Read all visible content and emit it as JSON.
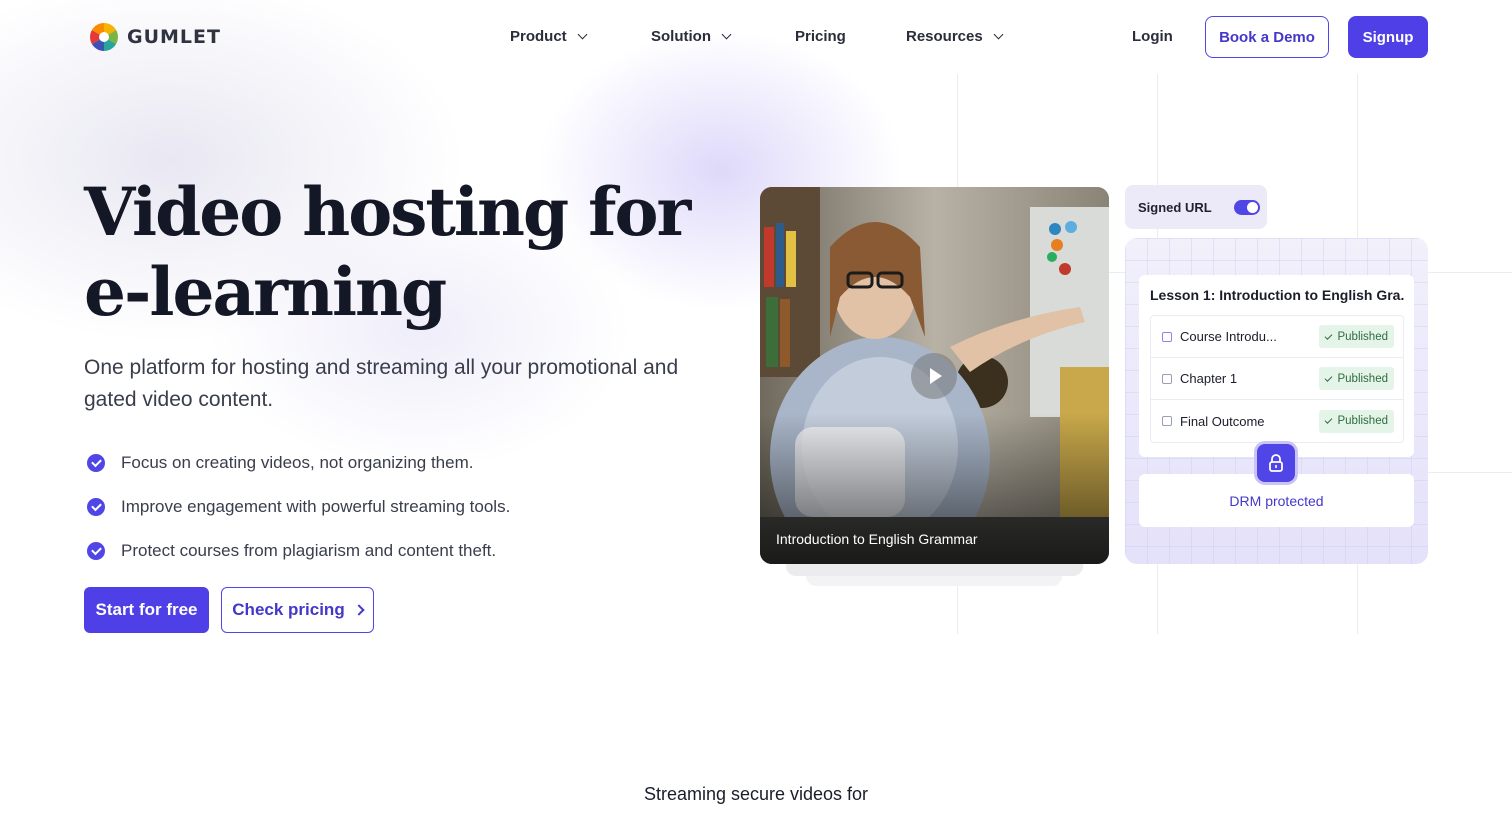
{
  "brand": {
    "name": "GUMLET"
  },
  "nav": {
    "items": [
      {
        "label": "Product",
        "dropdown": true
      },
      {
        "label": "Solution",
        "dropdown": true
      },
      {
        "label": "Pricing",
        "dropdown": false
      },
      {
        "label": "Resources",
        "dropdown": true
      }
    ],
    "login": "Login",
    "book_demo": "Book a Demo",
    "signup": "Signup"
  },
  "hero": {
    "title": "Video hosting for e-learning",
    "subtitle": "One platform for hosting and streaming all your promotional and gated video content.",
    "features": [
      "Focus on creating videos, not organizing them.",
      "Improve engagement with powerful streaming tools.",
      "Protect courses from plagiarism and content theft."
    ],
    "cta_primary": "Start for free",
    "cta_secondary": "Check pricing"
  },
  "video_card": {
    "caption": "Introduction to English Grammar"
  },
  "signed_url": {
    "label": "Signed URL",
    "enabled": true
  },
  "lesson_panel": {
    "title": "Lesson 1: Introduction to English Gra...",
    "items": [
      {
        "label": "Course Introdu...",
        "icon": "video-icon",
        "status": "Published"
      },
      {
        "label": "Chapter 1",
        "icon": "document-icon",
        "status": "Published"
      },
      {
        "label": "Final Outcome",
        "icon": "document-icon",
        "status": "Published"
      }
    ],
    "drm_label": "DRM protected"
  },
  "section_heading": "Streaming secure videos for",
  "colors": {
    "accent": "#4f3fe6",
    "published_bg": "#e5f4e8",
    "published_text": "#2f6b3e"
  }
}
